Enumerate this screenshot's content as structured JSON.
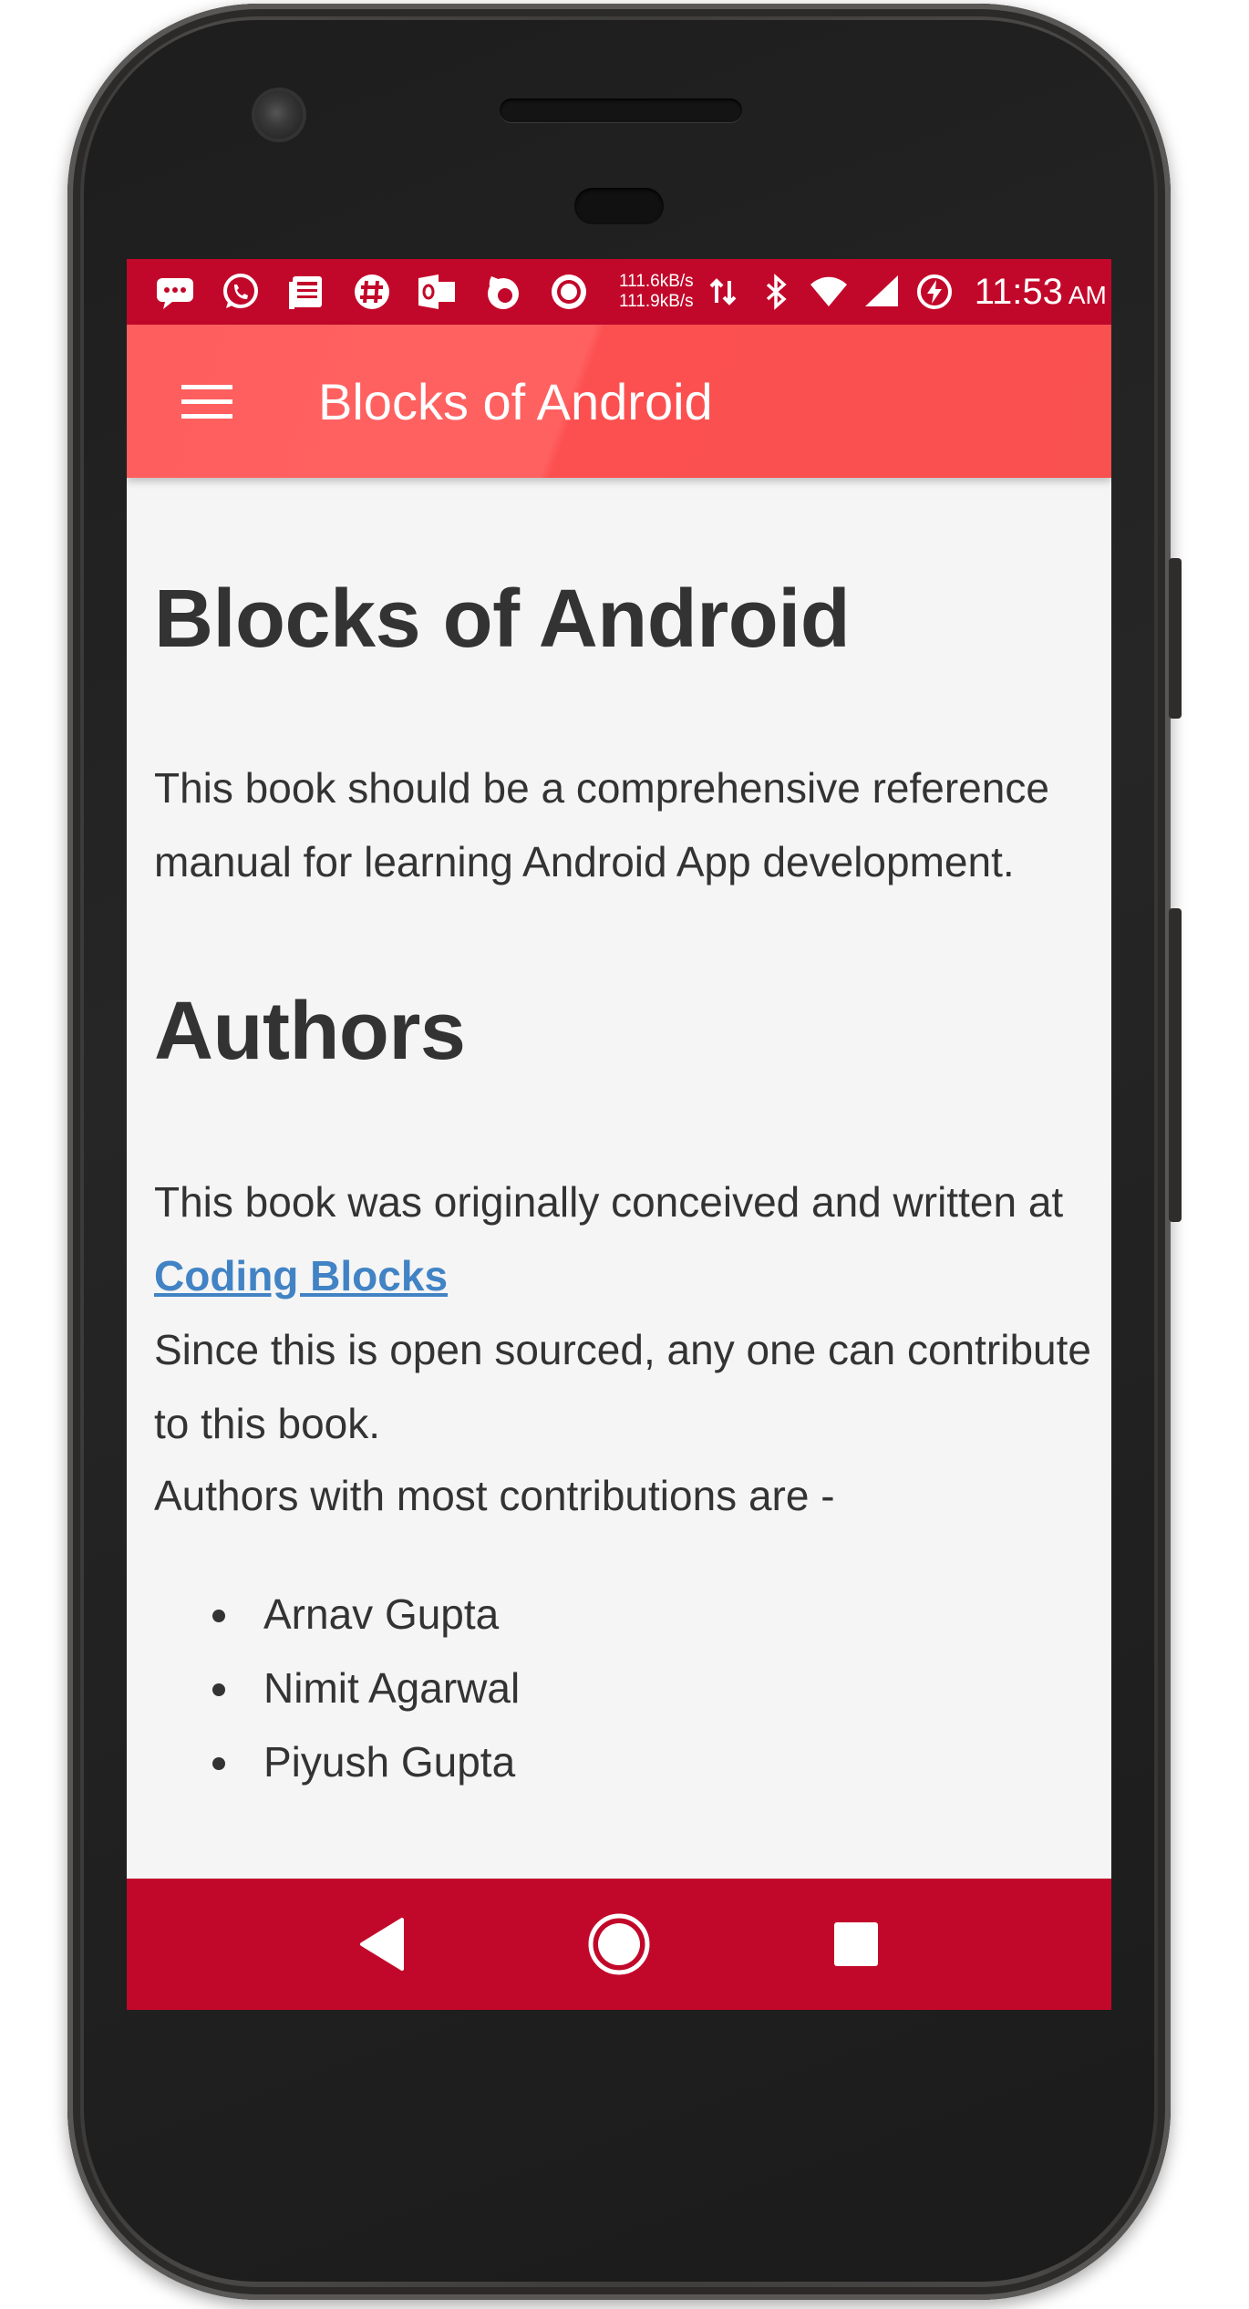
{
  "status_bar": {
    "icons_left": [
      "message-icon",
      "whatsapp-icon",
      "news-icon",
      "slack-icon",
      "outlook-icon",
      "firefox-icon",
      "record-icon"
    ],
    "net_speed_up": "111.6kB/s",
    "net_speed_down": "111.9kB/s",
    "icons_right": [
      "data-transfer-icon",
      "bluetooth-icon",
      "wifi-icon",
      "cell-signal-icon",
      "battery-charging-icon"
    ],
    "time": "11:53",
    "ampm": "AM",
    "color": "#c2082a"
  },
  "app_bar": {
    "menu_icon": "hamburger-menu-icon",
    "title": "Blocks of Android",
    "color": "#ff5e5e"
  },
  "content": {
    "heading": "Blocks of Android",
    "intro": "This book should be a comprehensive reference manual for learning Android App development.",
    "authors_heading": "Authors",
    "written_prefix": "This book was originally conceived and written at ",
    "link_text": "Coding Blocks",
    "open_source_text": "Since this is open sourced, any one can contribute to this book.",
    "most_contributions": "Authors with most contributions are -",
    "authors": [
      "Arnav Gupta",
      "Nimit Agarwal",
      "Piyush Gupta"
    ],
    "link_color": "#4183c4"
  },
  "nav_bar": {
    "back_icon": "back-triangle-icon",
    "home_icon": "home-circle-icon",
    "recents_icon": "recents-square-icon"
  }
}
